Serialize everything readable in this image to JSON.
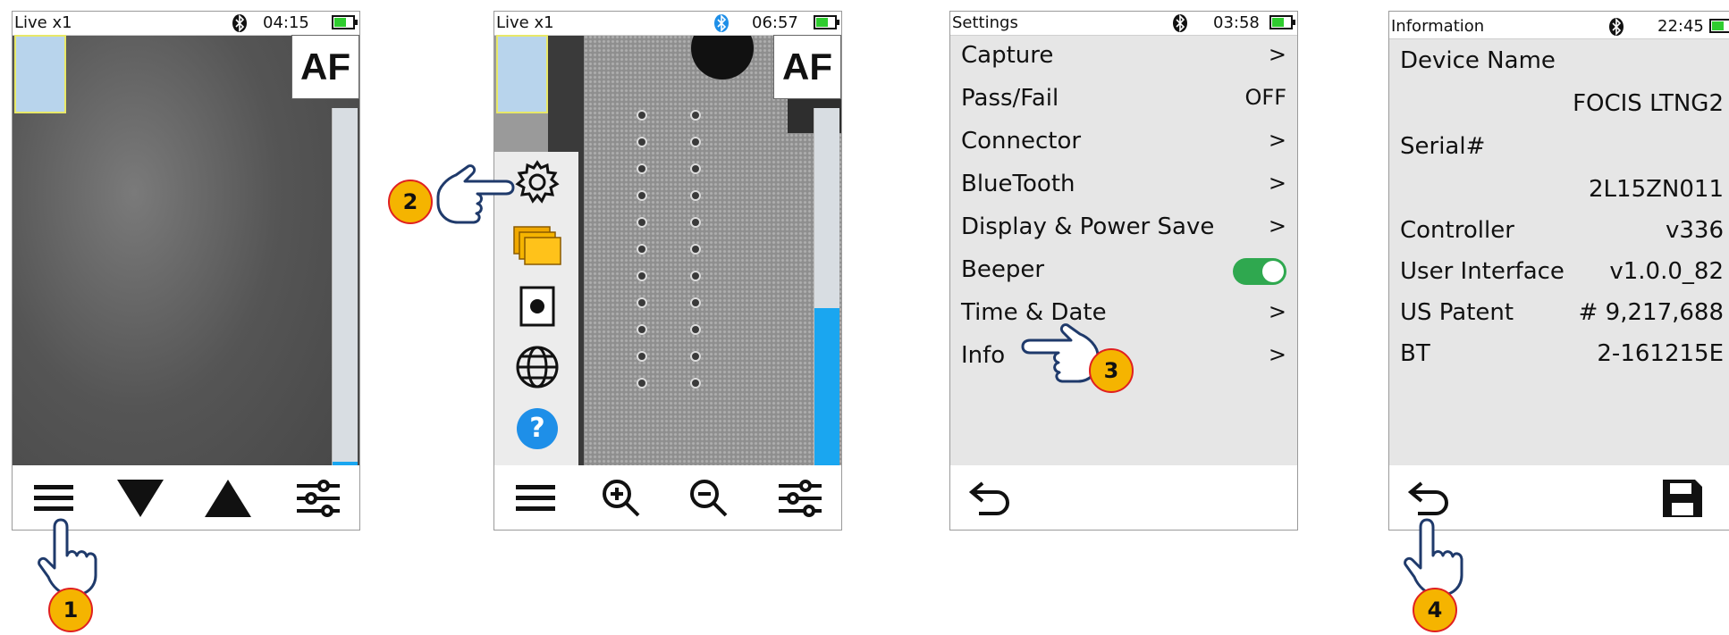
{
  "screen1": {
    "status": {
      "title": "Live x1",
      "time": "04:15"
    },
    "af_label": "AF",
    "bottom_icons": [
      "menu-icon",
      "triangle-down-icon",
      "triangle-up-icon",
      "sliders-icon"
    ]
  },
  "screen2": {
    "status": {
      "title": "Live x1",
      "time": "06:57"
    },
    "af_label": "AF",
    "side_menu": [
      "gear-icon",
      "folders-icon",
      "record-icon",
      "globe-icon",
      "help-icon"
    ],
    "help_label": "?",
    "bottom_icons": [
      "menu-icon",
      "zoom-in-icon",
      "zoom-out-icon",
      "sliders-icon"
    ]
  },
  "screen3": {
    "status": {
      "title": "Settings",
      "time": "03:58"
    },
    "items": [
      {
        "label": "Capture",
        "value": ">"
      },
      {
        "label": "Pass/Fail",
        "value": "OFF"
      },
      {
        "label": "Connector",
        "value": ">"
      },
      {
        "label": "BlueTooth",
        "value": ">"
      },
      {
        "label": "Display & Power Save",
        "value": ">"
      },
      {
        "label": "Beeper",
        "value": ""
      },
      {
        "label": "Time & Date",
        "value": ">"
      },
      {
        "label": "Info",
        "value": ">"
      }
    ],
    "beeper_on": true
  },
  "screen4": {
    "status": {
      "title": "Information",
      "time": "22:45"
    },
    "device_name_label": "Device Name",
    "device_name_value": "FOCIS LTNG2",
    "serial_label": "Serial#",
    "serial_value": "2L15ZN011",
    "rows": [
      {
        "label": "Controller",
        "value": "v336"
      },
      {
        "label": "User Interface",
        "value": "v1.0.0_82"
      },
      {
        "label": "US Patent",
        "value": "# 9,217,688"
      },
      {
        "label": "BT",
        "value": "2-161215E"
      }
    ]
  },
  "callouts": [
    "1",
    "2",
    "3",
    "4"
  ],
  "colors": {
    "battery": "#2fcc2f",
    "toggle": "#2fa84f",
    "callout": "#f5b400",
    "bt_blue": "#1e8fe8",
    "level": "#1aa6f0"
  }
}
